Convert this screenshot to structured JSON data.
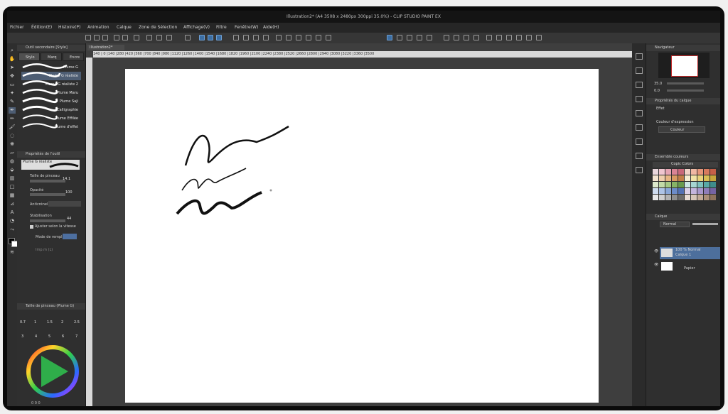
{
  "window": {
    "title": "Illustration2* (A4 3508 x 2480px 300ppi 35.0%) - CLIP STUDIO PAINT EX"
  },
  "menu": [
    "Fichier",
    "Édition(E)",
    "Histoire(P)",
    "Animation",
    "Calque",
    "Zone de Sélection",
    "Affichage(V)",
    "Filtre",
    "Fenêtre(W)",
    "Aide(H)"
  ],
  "sub_tool": {
    "title": "Outil secondaire [Style]",
    "tabs": [
      "Stylo",
      "Marq",
      "Encre"
    ],
    "brushes": [
      "Plume G",
      "Plume G réaliste",
      "Plume G réaliste 2",
      "Plume Maru",
      "Plume Saji",
      "Calligraphie",
      "Plume Effilée",
      "Plume d'effet"
    ],
    "selected_index": 1
  },
  "tool_property": {
    "title": "Propriétés de l'outil",
    "preset": "Plume G réaliste",
    "brush_size_label": "Taille de pinceau",
    "brush_size": "14.1",
    "opacity_label": "Opacité",
    "opacity": "100",
    "antialias_label": "Anticrénel.",
    "stabilization_label": "Stabilisation",
    "stabilization": "44",
    "speed_label": "Ajuster selon la vitesse",
    "speed_checked": true,
    "fill_mode_label": "Mode de rempl.",
    "vector_label": "Imp.m (L)"
  },
  "brush_size_panel": {
    "title": "Taille de pinceau (Plume G)",
    "sizes": [
      "0.7",
      "1",
      "1.5",
      "2",
      "2.5",
      "3",
      "4",
      "5",
      "6",
      "7"
    ]
  },
  "color_wheel": {
    "main": "#000000",
    "sub": "#ffffff",
    "hue": "#2fae4a",
    "values": "0 0 0"
  },
  "canvas": {
    "doc_tab": "Illustration2*",
    "ruler": "140 | 0 |140 |280 |420 |560 |700 |840 |980 |1120 |1260 |1400 |1540 |1680 |1820 |1960 |2100 |2240 |2380 |2520 |2660 |2800 |2940 |3080 |3220 |3360 |3500",
    "zoom": "35.0"
  },
  "navigator": {
    "title": "Navigateur",
    "zoom": "35.0",
    "angle": "0.0"
  },
  "layer_property": {
    "title": "Propriétés du calque",
    "effect_label": "Effet",
    "expression_label": "Couleur d'expression",
    "expression_value": "Couleur"
  },
  "color_set": {
    "title": "Ensemble couleurs",
    "set_name": "Copic Colors",
    "swatches": [
      "#e9d6dc",
      "#f0c6cf",
      "#e6a5b3",
      "#d98495",
      "#c8687a",
      "#f1d3c8",
      "#efb8a3",
      "#e6977b",
      "#d77a5e",
      "#c45f48",
      "#f3e3d0",
      "#f0cfac",
      "#e8b684",
      "#d89a62",
      "#c27f49",
      "#f6efd3",
      "#f1e3a6",
      "#e9d37c",
      "#d9bd55",
      "#c6a63c",
      "#dce9cc",
      "#c2dba8",
      "#a5c985",
      "#86b466",
      "#679a4e",
      "#cbe6e3",
      "#a6d6d2",
      "#7fc2be",
      "#58a9a6",
      "#3e8d8b",
      "#cfdcef",
      "#aec4e6",
      "#8aa8d9",
      "#6c8cc9",
      "#5271b4",
      "#dcd2ea",
      "#c4b5dd",
      "#a998cc",
      "#8f7db9",
      "#7563a3",
      "#e8e8e8",
      "#cfcfcf",
      "#b2b2b2",
      "#8f8f8f",
      "#6b6b6b",
      "#e8ddd5",
      "#d7c6b8",
      "#c2aa97",
      "#aa8e78",
      "#8f735d"
    ]
  },
  "layers": {
    "title": "Calque",
    "blend_mode": "Normal",
    "items": [
      {
        "name": "Calque 1",
        "info": "100 % Normal",
        "selected": true
      },
      {
        "name": "Papier",
        "info": "",
        "selected": false
      }
    ]
  }
}
